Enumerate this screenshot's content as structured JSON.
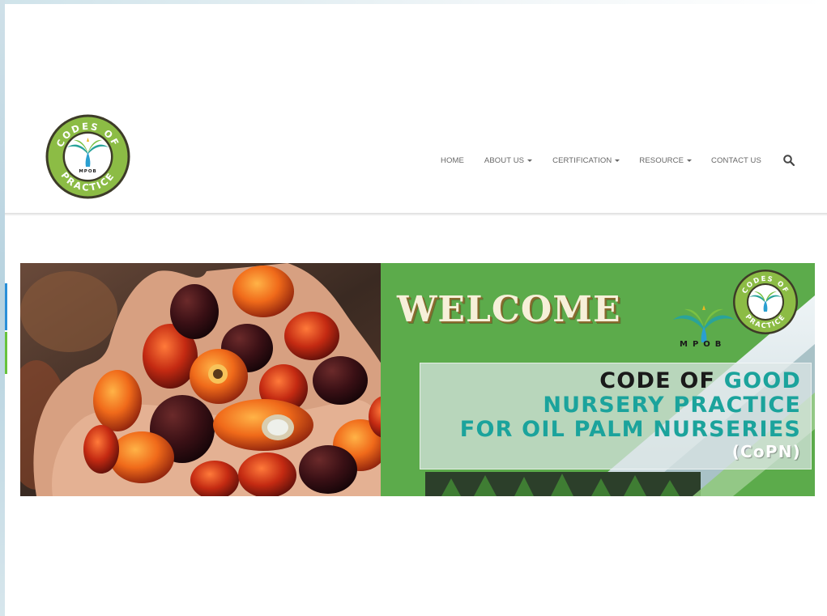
{
  "header": {
    "logo": {
      "ring_text_top": "CODES OF",
      "ring_text_bottom": "PRACTICE",
      "center_text": "MPOB"
    },
    "nav": [
      {
        "label": "HOME",
        "dropdown": false
      },
      {
        "label": "ABOUT US",
        "dropdown": true
      },
      {
        "label": "CERTIFICATION",
        "dropdown": true
      },
      {
        "label": "RESOURCE",
        "dropdown": true
      },
      {
        "label": "CONTACT US",
        "dropdown": false
      }
    ],
    "search_icon": "search-icon"
  },
  "banner": {
    "welcome": "WELCOME",
    "mpob_label": "MPOB",
    "badge": {
      "ring_text_top": "CODES OF",
      "ring_text_bottom": "PRACTICE"
    },
    "title_line1_dark": "CODE OF ",
    "title_line1_teal": "GOOD",
    "title_line2": "NURSERY PRACTICE",
    "title_line3": "FOR OIL PALM NURSERIES",
    "title_line4": "(CoPN)"
  },
  "colors": {
    "banner_green": "#5cab4b",
    "teal_text": "#1ba39c",
    "nav_text": "#666666",
    "logo_ring_green": "#7aac3a"
  }
}
